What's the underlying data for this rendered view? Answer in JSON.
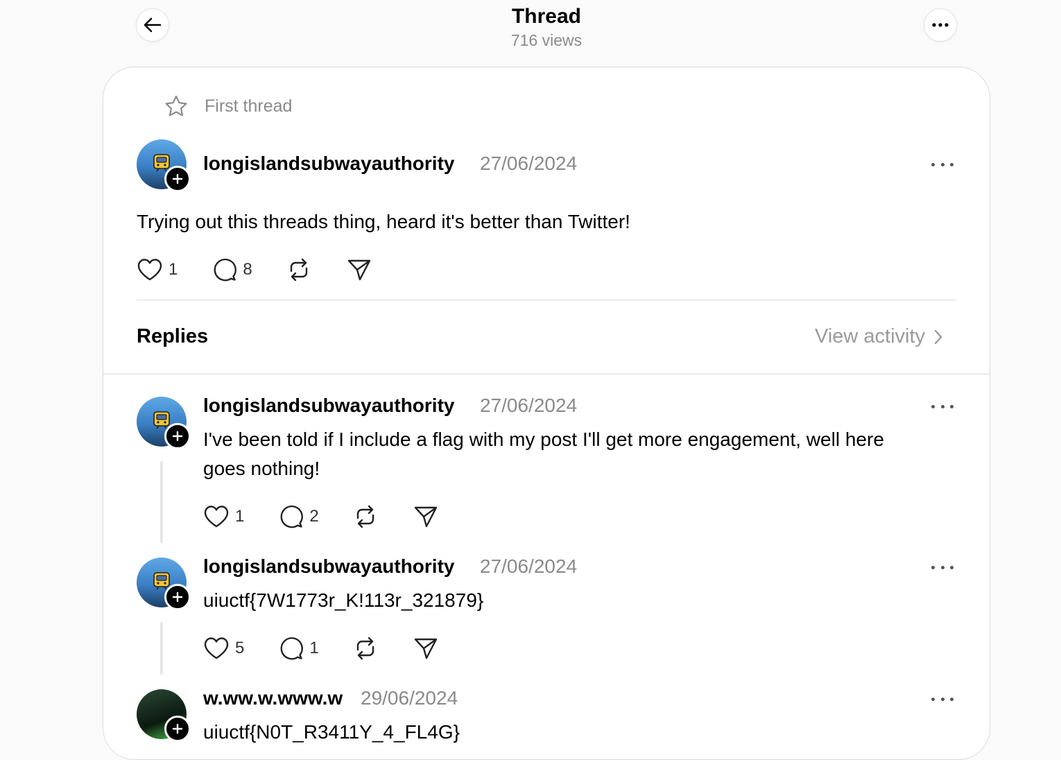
{
  "header": {
    "title": "Thread",
    "views": "716 views"
  },
  "first_thread_label": "First thread",
  "main_post": {
    "username": "longislandsubwayauthority",
    "date": "27/06/2024",
    "text": "Trying out this threads thing, heard it's better than Twitter!",
    "likes": "1",
    "comments": "8"
  },
  "replies_section": {
    "title": "Replies",
    "view_activity": "View activity"
  },
  "replies": [
    {
      "username": "longislandsubwayauthority",
      "date": "27/06/2024",
      "text": "I've been told if I include a flag with my post I'll get more engagement, well here goes nothing!",
      "likes": "1",
      "comments": "2"
    },
    {
      "username": "longislandsubwayauthority",
      "date": "27/06/2024",
      "text": "uiuctf{7W1773r_K!113r_321879}",
      "likes": "5",
      "comments": "1"
    },
    {
      "username": "w.ww.w.www.w",
      "date": "29/06/2024",
      "text": "uiuctf{N0T_R3411Y_4_FL4G}"
    }
  ]
}
